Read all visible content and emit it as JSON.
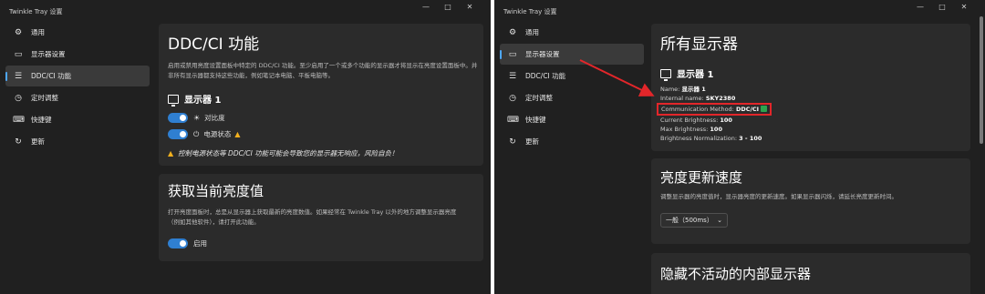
{
  "left": {
    "window_title": "Twinkle Tray 设置",
    "controls": [
      "—",
      "□",
      "✕"
    ],
    "nav": [
      {
        "icon": "gear-icon",
        "glyph": "⚙",
        "label": "通用"
      },
      {
        "icon": "monitor-icon",
        "glyph": "▭",
        "label": "显示器设置"
      },
      {
        "icon": "sliders-icon",
        "glyph": "☰",
        "label": "DDC/CI 功能"
      },
      {
        "icon": "clock-icon",
        "glyph": "◷",
        "label": "定时调整"
      },
      {
        "icon": "keyboard-icon",
        "glyph": "⌨",
        "label": "快捷键"
      },
      {
        "icon": "refresh-icon",
        "glyph": "↻",
        "label": "更新"
      }
    ],
    "ddc_card": {
      "title": "DDC/CI 功能",
      "desc": "启用或禁用亮度设置面板中特定的 DDC/CI 功能。至少启用了一个或多个功能的显示器才将显示在亮度设置面板中。并非所有显示器都支持这些功能，例如笔记本电脑、平板电脑等。",
      "monitor_title": "显示器 1",
      "toggle_contrast": "对比度",
      "toggle_power": "电源状态",
      "warning": "控制电源状态等 DDC/CI 功能可能会导致您的显示器无响应，风险自负！"
    },
    "brightness_card": {
      "title": "获取当前亮度值",
      "desc": "打开亮度面板时，总是从显示器上获取最新的亮度数值。如果经常在 Twinkle Tray 以外的地方调整显示器亮度（例如其他软件），请打开此功能。",
      "toggle_label": "启用"
    }
  },
  "right": {
    "window_title": "Twinkle Tray 设置",
    "controls": [
      "—",
      "□",
      "✕"
    ],
    "nav": [
      {
        "icon": "gear-icon",
        "glyph": "⚙",
        "label": "通用"
      },
      {
        "icon": "monitor-icon",
        "glyph": "▭",
        "label": "显示器设置"
      },
      {
        "icon": "sliders-icon",
        "glyph": "☰",
        "label": "DDC/CI 功能"
      },
      {
        "icon": "clock-icon",
        "glyph": "◷",
        "label": "定时调整"
      },
      {
        "icon": "keyboard-icon",
        "glyph": "⌨",
        "label": "快捷键"
      },
      {
        "icon": "refresh-icon",
        "glyph": "↻",
        "label": "更新"
      }
    ],
    "all_monitors": {
      "title": "所有显示器",
      "monitor_title": "显示器 1",
      "name_label": "Name:",
      "name_value": "显示器 1",
      "internal_label": "Internal name:",
      "internal_value": "SKY2380",
      "comm_label": "Communication Method:",
      "comm_value": "DDC/CI",
      "current_label": "Current Brightness:",
      "current_value": "100",
      "max_label": "Max Brightness:",
      "max_value": "100",
      "norm_label": "Brightness Normalization:",
      "norm_value": "3 - 100"
    },
    "update_rate": {
      "title": "亮度更新速度",
      "desc": "调整显示器的亮度值时，显示器亮度的更新速度。如果显示器闪烁，请延长亮度更新时间。",
      "select_value": "一般（500ms）"
    },
    "hide_internal": {
      "title": "隐藏不活动的内部显示器"
    }
  },
  "accent": "#2f7fd1",
  "highlight_color": "#e3262a"
}
